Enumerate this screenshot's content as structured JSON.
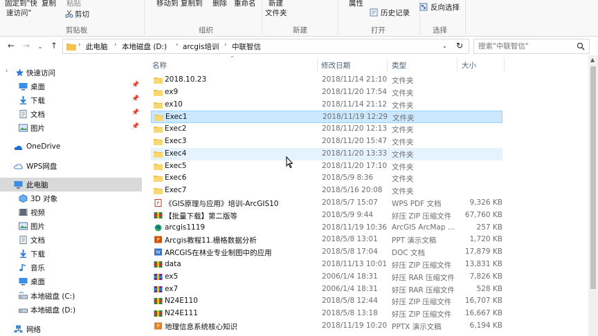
{
  "ribbon": {
    "clipboard": {
      "pin_quick_access": "固定到\"快\n速访问\"",
      "pin_line1": "固定到\"快",
      "pin_line2": "速访问\"",
      "copy": "复制",
      "paste": "粘贴",
      "cut": "剪切",
      "group_label": "剪贴板"
    },
    "organize": {
      "move_to": "移动到",
      "copy_to": "复制到",
      "delete": "删除",
      "rename": "重命名",
      "group_label": "组织"
    },
    "new": {
      "new_folder_line1": "新建",
      "new_folder_line2": "文件夹",
      "group_label": "新建"
    },
    "open": {
      "properties": "属性",
      "history": "历史记录",
      "group_label": "打开"
    },
    "select": {
      "invert": "反向选择",
      "group_label": "选择"
    }
  },
  "address": {
    "crumbs": [
      "此电脑",
      "本地磁盘 (D:)",
      "arcgis培训",
      "中联智信"
    ],
    "search_placeholder": "搜索\"中联智信\""
  },
  "nav": {
    "items": [
      {
        "label": "快速访问",
        "icon": "star-icon",
        "pinned": false
      },
      {
        "label": "桌面",
        "icon": "desktop-icon",
        "pinned": true
      },
      {
        "label": "下载",
        "icon": "download-icon",
        "pinned": true
      },
      {
        "label": "文档",
        "icon": "document-icon",
        "pinned": true
      },
      {
        "label": "图片",
        "icon": "picture-icon",
        "pinned": true
      },
      {
        "label": "OneDrive",
        "icon": "cloud-icon",
        "pinned": false
      },
      {
        "label": "WPS网盘",
        "icon": "wps-cloud-icon",
        "pinned": false
      },
      {
        "label": "此电脑",
        "icon": "computer-icon",
        "pinned": false
      },
      {
        "label": "3D 对象",
        "icon": "3d-objects-icon",
        "pinned": false
      },
      {
        "label": "视频",
        "icon": "video-icon",
        "pinned": false
      },
      {
        "label": "图片",
        "icon": "picture-icon",
        "pinned": false
      },
      {
        "label": "文档",
        "icon": "document-icon",
        "pinned": false
      },
      {
        "label": "下载",
        "icon": "download-icon",
        "pinned": false
      },
      {
        "label": "音乐",
        "icon": "music-icon",
        "pinned": false
      },
      {
        "label": "桌面",
        "icon": "desktop-icon",
        "pinned": false
      },
      {
        "label": "本地磁盘 (C:)",
        "icon": "drive-icon",
        "pinned": false
      },
      {
        "label": "本地磁盘 (D:)",
        "icon": "drive-icon",
        "pinned": false
      },
      {
        "label": "网络",
        "icon": "network-icon",
        "pinned": false
      }
    ]
  },
  "columns": {
    "name": "名称",
    "date": "修改日期",
    "type": "类型",
    "size": "大小"
  },
  "files": [
    {
      "name": "2018.10.23",
      "date": "2018/11/14 21:10",
      "type": "文件夹",
      "size": "",
      "icon": "folder-icon"
    },
    {
      "name": "ex9",
      "date": "2018/11/20 17:54",
      "type": "文件夹",
      "size": "",
      "icon": "folder-icon"
    },
    {
      "name": "ex10",
      "date": "2018/11/14 21:12",
      "type": "文件夹",
      "size": "",
      "icon": "folder-icon"
    },
    {
      "name": "Exec1",
      "date": "2018/11/19 12:29",
      "type": "文件夹",
      "size": "",
      "icon": "folder-icon"
    },
    {
      "name": "Exec2",
      "date": "2018/11/20 12:13",
      "type": "文件夹",
      "size": "",
      "icon": "folder-icon"
    },
    {
      "name": "Exec3",
      "date": "2018/11/20 15:47",
      "type": "文件夹",
      "size": "",
      "icon": "folder-icon"
    },
    {
      "name": "Exec4",
      "date": "2018/11/20 13:33",
      "type": "文件夹",
      "size": "",
      "icon": "folder-icon"
    },
    {
      "name": "Exec5",
      "date": "2018/11/20 17:10",
      "type": "文件夹",
      "size": "",
      "icon": "folder-icon"
    },
    {
      "name": "Exec6",
      "date": "2018/5/9 8:36",
      "type": "文件夹",
      "size": "",
      "icon": "folder-icon"
    },
    {
      "name": "Exec7",
      "date": "2018/5/16 20:08",
      "type": "文件夹",
      "size": "",
      "icon": "folder-icon"
    },
    {
      "name": "《GIS原理与应用》培训-ArcGIS10",
      "date": "2018/5/7 15:07",
      "type": "WPS PDF 文档",
      "size": "9,326 KB",
      "icon": "pdf-icon"
    },
    {
      "name": "【批量下载】第二版等",
      "date": "2018/5/9 9:44",
      "type": "好压 ZIP 压缩文件",
      "size": "67,760 KB",
      "icon": "zip-icon"
    },
    {
      "name": "arcgis1119",
      "date": "2018/11/19 10:36",
      "type": "ArcGIS ArcMap ...",
      "size": "257 KB",
      "icon": "arcmap-icon"
    },
    {
      "name": "Arcgis教程11.栅格数据分析",
      "date": "2018/5/8 13:01",
      "type": "PPT 演示文稿",
      "size": "1,720 KB",
      "icon": "ppt-icon"
    },
    {
      "name": "ARCGIS在林业专业制图中的应用",
      "date": "2018/5/8 17:04",
      "type": "DOC 文档",
      "size": "17,879 KB",
      "icon": "doc-icon"
    },
    {
      "name": "data",
      "date": "2018/11/13 10:01",
      "type": "好压 ZIP 压缩文件",
      "size": "13,831 KB",
      "icon": "zip-icon"
    },
    {
      "name": "ex5",
      "date": "2006/1/4 18:31",
      "type": "好压 RAR 压缩文件",
      "size": "7,826 KB",
      "icon": "rar-icon"
    },
    {
      "name": "ex7",
      "date": "2006/1/4 18:31",
      "type": "好压 RAR 压缩文件",
      "size": "528 KB",
      "icon": "rar-icon"
    },
    {
      "name": "N24E110",
      "date": "2018/5/8 12:44",
      "type": "好压 ZIP 压缩文件",
      "size": "16,707 KB",
      "icon": "zip-icon"
    },
    {
      "name": "N24E111",
      "date": "2018/5/8 13:18",
      "type": "好压 ZIP 压缩文件",
      "size": "16,667 KB",
      "icon": "zip-icon"
    },
    {
      "name": "地理信息系统核心知识",
      "date": "2018/11/19 10:20",
      "type": "PPTX 演示文稿",
      "size": "6,194 KB",
      "icon": "pptx-icon"
    }
  ],
  "selection": {
    "selected_name": "Exec1",
    "hover_name": "Exec4"
  },
  "colors": {
    "selected_bg": "#cce8ff",
    "hover_bg": "#e5f3ff",
    "folder": "#f2c14e",
    "header_text": "#4c607a"
  }
}
